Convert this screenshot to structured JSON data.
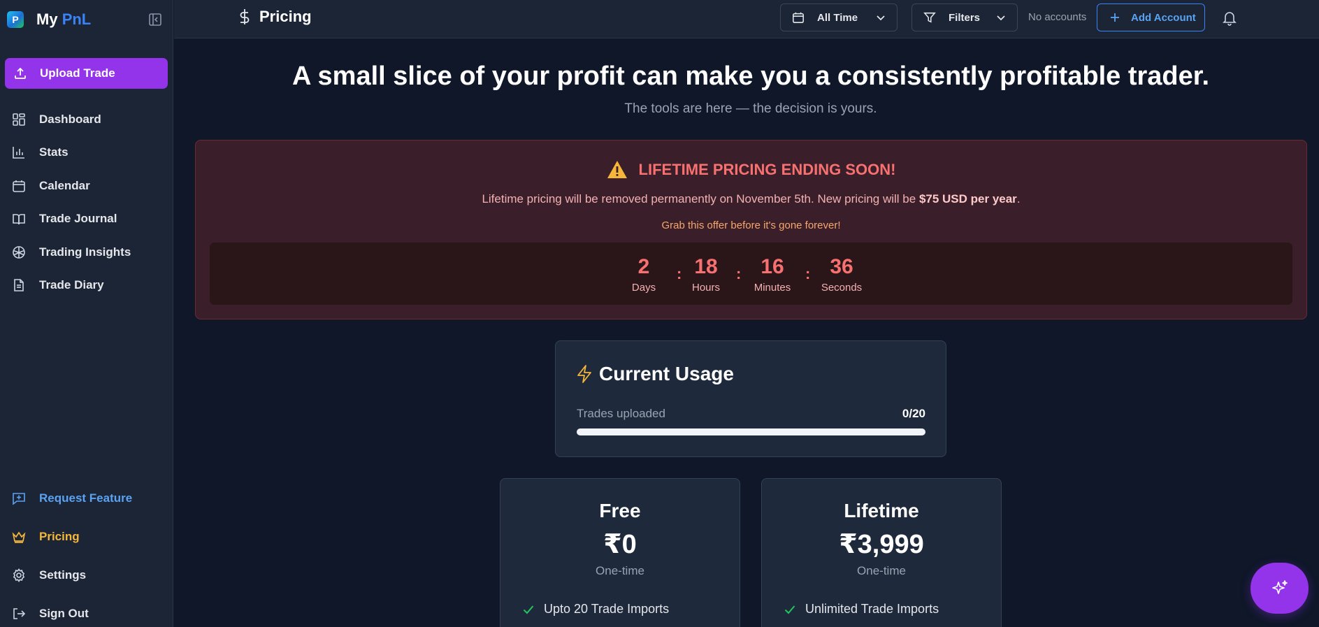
{
  "app": {
    "brand_prefix": "My ",
    "brand_accent": "PnL",
    "logo_letter": "P"
  },
  "sidebar": {
    "upload_label": "Upload Trade",
    "items": [
      {
        "label": "Dashboard",
        "icon": "dashboard-icon"
      },
      {
        "label": "Stats",
        "icon": "bar-chart-icon"
      },
      {
        "label": "Calendar",
        "icon": "calendar-icon"
      },
      {
        "label": "Trade Journal",
        "icon": "book-icon"
      },
      {
        "label": "Trading Insights",
        "icon": "brain-icon"
      },
      {
        "label": "Trade Diary",
        "icon": "document-icon"
      }
    ],
    "bottom_items": [
      {
        "label": "Request Feature",
        "icon": "message-plus-icon"
      },
      {
        "label": "Pricing",
        "icon": "crown-icon"
      },
      {
        "label": "Settings",
        "icon": "gear-icon"
      },
      {
        "label": "Sign Out",
        "icon": "sign-out-icon"
      }
    ]
  },
  "header": {
    "title": "Pricing",
    "date_filter": "All Time",
    "filters_label": "Filters",
    "no_accounts": "No accounts",
    "add_account": "Add Account"
  },
  "main": {
    "headline": "A small slice of your profit can make you a consistently profitable trader.",
    "subline": "The tools are here — the decision is yours."
  },
  "promo": {
    "title": "LIFETIME PRICING ENDING SOON!",
    "text_before": "Lifetime pricing will be removed permanently on November 5th. New pricing will be ",
    "text_bold": "$75 USD per year",
    "text_after": ".",
    "cta": "Grab this offer before it's gone forever!",
    "countdown": [
      {
        "value": "2",
        "label": "Days"
      },
      {
        "value": "18",
        "label": "Hours"
      },
      {
        "value": "16",
        "label": "Minutes"
      },
      {
        "value": "36",
        "label": "Seconds"
      }
    ],
    "separator": ":"
  },
  "usage": {
    "title": "Current Usage",
    "label": "Trades uploaded",
    "count": "0/20",
    "progress": 0
  },
  "plans": [
    {
      "name": "Free",
      "price": "₹0",
      "period": "One-time",
      "feature": "Upto 20 Trade Imports"
    },
    {
      "name": "Lifetime",
      "price": "₹3,999",
      "period": "One-time",
      "feature": "Unlimited Trade Imports"
    }
  ],
  "colors": {
    "accent": "#9333ea",
    "blue": "#3b82f6",
    "gold": "#f5b63a",
    "alert": "#f87171",
    "background": "#0f1729",
    "panel": "#1b2536"
  }
}
